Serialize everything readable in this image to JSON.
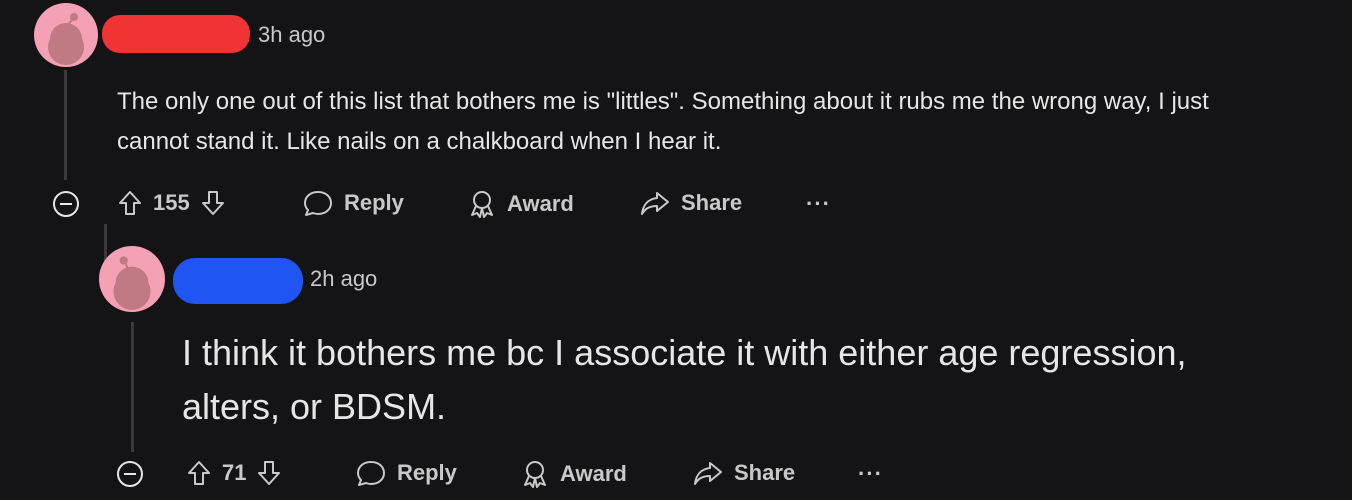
{
  "comments": [
    {
      "time": "3h ago",
      "redaction_color": "#f03333",
      "body": "The only one out of this list that bothers me is \"littles\". Something about it rubs me the wrong way, I just cannot stand it. Like nails on a chalkboard when I hear it.",
      "votes": "155",
      "reply_label": "Reply",
      "award_label": "Award",
      "share_label": "Share",
      "more_label": "···"
    },
    {
      "time": "2h ago",
      "redaction_color": "#1f55f0",
      "body": "I think it bothers me bc I associate it with either age regression, alters, or BDSM.",
      "votes": "71",
      "reply_label": "Reply",
      "award_label": "Award",
      "share_label": "Share",
      "more_label": "···"
    }
  ],
  "colors": {
    "background": "#141416",
    "avatar": "#f4a0b5",
    "text": "#e6e6e6",
    "muted": "#c9c9c9"
  }
}
